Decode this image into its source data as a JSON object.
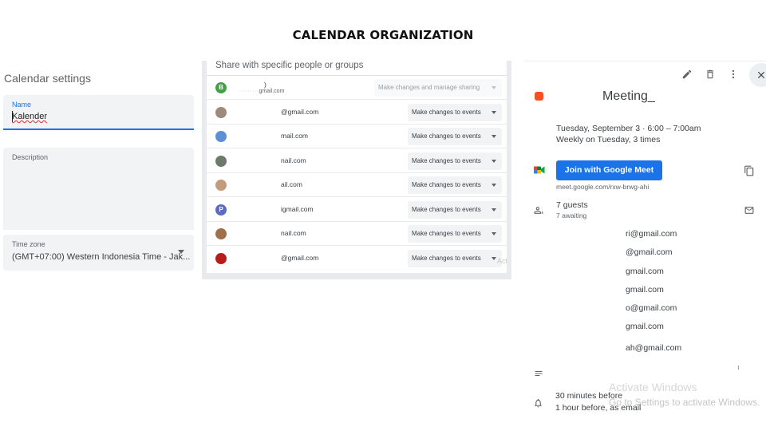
{
  "slide_title": "CALENDAR ORGANIZATION",
  "settings": {
    "heading": "Calendar settings",
    "name_label": "Name",
    "name_value": "Kalender",
    "description_label": "Description",
    "timezone_label": "Time zone",
    "timezone_value": "(GMT+07:00) Western Indonesia Time - Jak..."
  },
  "sharing": {
    "heading": "Share with specific people or groups",
    "owner": {
      "avatar_letter": "B",
      "avatar_color": "#43a047",
      "email_line1": ")",
      "email_line2_dots": "·········",
      "email_line2": "gmail.com",
      "permission": "Make changes and manage sharing"
    },
    "rows": [
      {
        "email": "⁠@gmail.com",
        "permission": "Make changes to events",
        "avatar_color": "#9e8a7a"
      },
      {
        "email": "mail.com",
        "permission": "Make changes to events",
        "avatar_color": "#5c8fd6"
      },
      {
        "email": "nail.com",
        "permission": "Make changes to events",
        "avatar_color": "#6d7b6a"
      },
      {
        "email": "ail.com",
        "permission": "Make changes to events",
        "avatar_color": "#c49a7c"
      },
      {
        "email": "igmail.com",
        "permission": "Make changes to events",
        "avatar_color": "#5c6bc0",
        "avatar_letter": "P"
      },
      {
        "email": "nail.com",
        "permission": "Make changes to events",
        "avatar_color": "#a0704c"
      },
      {
        "email": "@gmail.com",
        "permission": "Make changes to events",
        "avatar_color": "#b71c1c"
      }
    ],
    "overlay_text": "Acti"
  },
  "event": {
    "title": "Meeting_",
    "color": "#f4511e",
    "date": "Tuesday, September 3  ·  6:00 – 7:00am",
    "recurrence": "Weekly on Tuesday, 3 times",
    "join_button": "Join with Google Meet",
    "meet_link": "meet.google.com/rxw-brwg-ahi",
    "guests_count": "7 guests",
    "guests_awaiting": "7 awaiting",
    "guests": [
      "ri@gmail.com",
      "@gmail.com",
      "gmail.com",
      "gmail.com",
      "o@gmail.com",
      "gmail.com",
      "ah@gmail.com"
    ],
    "notification_1": "30 minutes before",
    "notification_2": "1 hour before, as email"
  },
  "watermark": {
    "line1": "Activate Windows",
    "line2": "Go to Settings to activate Windows."
  }
}
